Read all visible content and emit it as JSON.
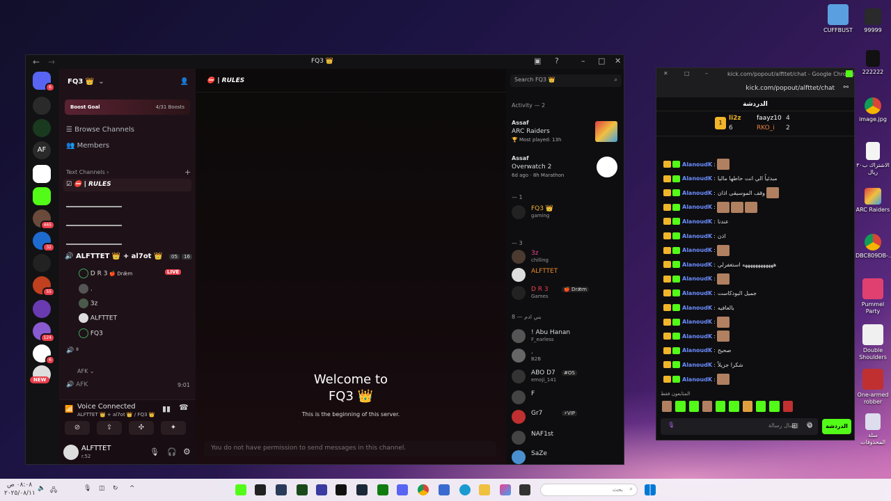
{
  "desktop": {
    "icons": [
      {
        "label": "CUFFBUST",
        "color": "#5aa0e0"
      },
      {
        "label": "99999",
        "color": "#333"
      },
      {
        "label": "222222",
        "color": "#222"
      },
      {
        "label": "image.jpg",
        "color": "#ffffff"
      },
      {
        "label": "الاشتراك ب٣٠ ريال",
        "color": "#f4f4f4"
      },
      {
        "label": "ARC Raiders",
        "color": "#e04040"
      },
      {
        "label": "DBC809DB-...",
        "color": "#ffffff"
      },
      {
        "label": "Pummel Party",
        "color": "#e04070"
      },
      {
        "label": "Double Shoulders",
        "color": "#ffffff"
      },
      {
        "label": "One-armed robber",
        "color": "#c03030"
      },
      {
        "label": "سلة المحذوفات",
        "color": "#dde"
      }
    ]
  },
  "discord": {
    "window_title": "FQ3 👑",
    "server_badges": [
      "6",
      "465",
      "32",
      "55",
      "124",
      "6"
    ],
    "new_badge": "NEW",
    "server_initials": "AF",
    "server_name": "FQ3 👑",
    "boost_goal": "Boost Goal",
    "boost_count": "4/31 Boosts",
    "browse_channels": "Browse Channels",
    "members_link": "Members",
    "text_channels_header": "Text Channels",
    "rules_channel": "| RULES",
    "voice_channel_name": "ALFTTET 👑 + al7ot 👑",
    "voice_counts": [
      "05",
      "16"
    ],
    "voice_users": [
      {
        "name": "D R 3",
        "tag": "🍎 Drǣm",
        "live": "LIVE"
      },
      {
        "name": ".",
        "tag": ""
      },
      {
        "name": "3z",
        "tag": ""
      },
      {
        "name": "ALFTTET",
        "tag": ""
      },
      {
        "name": "FQ3",
        "tag": ""
      }
    ],
    "voice_small_count": "8",
    "afk_header": "AFK",
    "afk_channel": "AFK",
    "afk_time": "9:01",
    "voice_connected": "Voice Connected",
    "voice_connected_sub": "ALFTTET 👑 + al7ot 👑 / FQ3 👑",
    "user_name": "ALFTTET",
    "user_tag": "r.52",
    "channel_header": "| RULES",
    "welcome_title": "Welcome to",
    "welcome_server": "FQ3 👑",
    "welcome_sub": "This is the beginning of this server.",
    "no_permission": "You do not have permission to send messages in this channel.",
    "search_placeholder": "Search FQ3 👑",
    "activity_header": "Activity — 2",
    "activities": [
      {
        "user": "Assaf",
        "game": "ARC Raiders",
        "detail": "🏆 Most played: 13h"
      },
      {
        "user": "Assaf",
        "game": "Overwatch 2",
        "detail": "6d ago · 8h Marathon"
      }
    ],
    "role_sections": [
      "— 1",
      "— 3",
      "بني ادم — 8"
    ],
    "members": [
      {
        "name": "FQ3 👑",
        "status": "gaming",
        "color": "#f0b232"
      },
      {
        "name": "3z",
        "status": "chilling",
        "color": "#f04590"
      },
      {
        "name": "ALFTTET",
        "status": "",
        "color": "#f08a2a"
      },
      {
        "name": "D R 3",
        "status": "Games",
        "color": "#f04050",
        "tag": "🍎 Drǣm"
      },
      {
        "name": "! Abu Hanan",
        "status": "F_earless",
        "color": "#dbdee1"
      },
      {
        "name": ".",
        "status": "B2B",
        "color": "#dbdee1"
      },
      {
        "name": "ABO D7",
        "status": "emoji_141",
        "color": "#dbdee1",
        "tag": "#OS"
      },
      {
        "name": "F",
        "status": "",
        "color": "#dbdee1"
      },
      {
        "name": "Gr7",
        "status": "",
        "color": "#dbdee1",
        "tag": "⚡VIP"
      },
      {
        "name": "NAF1st",
        "status": "",
        "color": "#dbdee1"
      },
      {
        "name": "SaZe",
        "status": "",
        "color": "#dbdee1"
      }
    ]
  },
  "kick": {
    "title": "kick.com/popout/alfttet/chat - Google Chrome",
    "url": "kick.com/popout/alfttet/chat",
    "chat_label": "الدردشة",
    "leaders": [
      {
        "name": "li2z",
        "count": "6"
      },
      {
        "name": "faayz10",
        "count": "4"
      },
      {
        "name": "RKO_i",
        "count": "2"
      }
    ],
    "messages": [
      {
        "user": "AlanoudK",
        "text": ""
      },
      {
        "user": "AlanoudK",
        "text": "مبدئياً الي انت حاطها ماليا"
      },
      {
        "user": "AlanoudK",
        "text": "وقف الموسيقى اذان"
      },
      {
        "user": "AlanoudK",
        "text": ""
      },
      {
        "user": "AlanoudK",
        "text": "عندنا"
      },
      {
        "user": "AlanoudK",
        "text": "اذن"
      },
      {
        "user": "AlanoudK",
        "text": ""
      },
      {
        "user": "AlanoudK",
        "text": "ههههههههههههه استغفرلي"
      },
      {
        "user": "AlanoudK",
        "text": ""
      },
      {
        "user": "AlanoudK",
        "text": "جميل البودكاست"
      },
      {
        "user": "AlanoudK",
        "text": "بالعافيه"
      },
      {
        "user": "AlanoudK",
        "text": ""
      },
      {
        "user": "AlanoudK",
        "text": ""
      },
      {
        "user": "AlanoudK",
        "text": "صحيح"
      },
      {
        "user": "AlanoudK",
        "text": "شكرا جزيلاً"
      },
      {
        "user": "AlanoudK",
        "text": ""
      }
    ],
    "emote_label": "المتابعون فقط",
    "input_placeholder": "إرسال رسالة",
    "send_label": "الدردشة"
  },
  "taskbar": {
    "search_placeholder": "بحث",
    "time": "٠٨:٠٨ ص",
    "date": "٢٠٢٥/٠٨/١١"
  }
}
